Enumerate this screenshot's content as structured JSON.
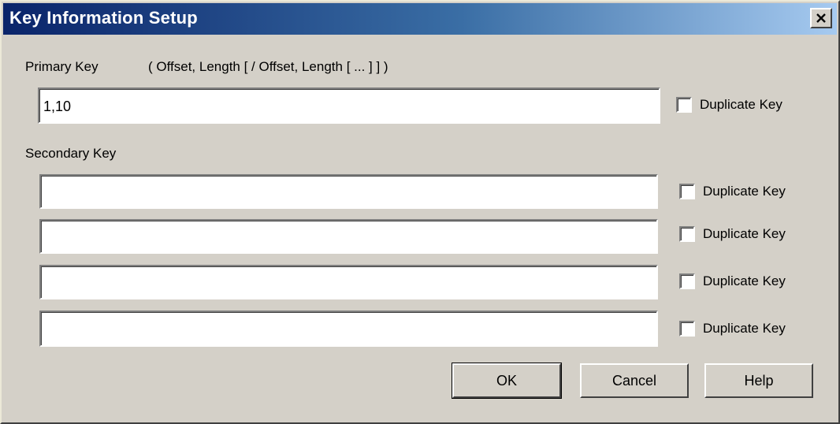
{
  "window": {
    "title": "Key Information Setup",
    "close_symbol": "✕"
  },
  "primary": {
    "label": "Primary Key",
    "format_hint": "( Offset, Length [ / Offset, Length [ ... ] ] )",
    "value": "1,10",
    "duplicate_label": "Duplicate Key",
    "duplicate_checked": false
  },
  "secondary": {
    "label": "Secondary Key",
    "fields": [
      {
        "value": "",
        "duplicate_label": "Duplicate Key",
        "duplicate_checked": false
      },
      {
        "value": "",
        "duplicate_label": "Duplicate Key",
        "duplicate_checked": false
      },
      {
        "value": "",
        "duplicate_label": "Duplicate Key",
        "duplicate_checked": false
      },
      {
        "value": "",
        "duplicate_label": "Duplicate Key",
        "duplicate_checked": false
      }
    ]
  },
  "buttons": {
    "ok": "OK",
    "cancel": "Cancel",
    "help": "Help"
  },
  "colors": {
    "face": "#d4d0c8",
    "title_start": "#0a246a",
    "title_end": "#a6caf0"
  }
}
